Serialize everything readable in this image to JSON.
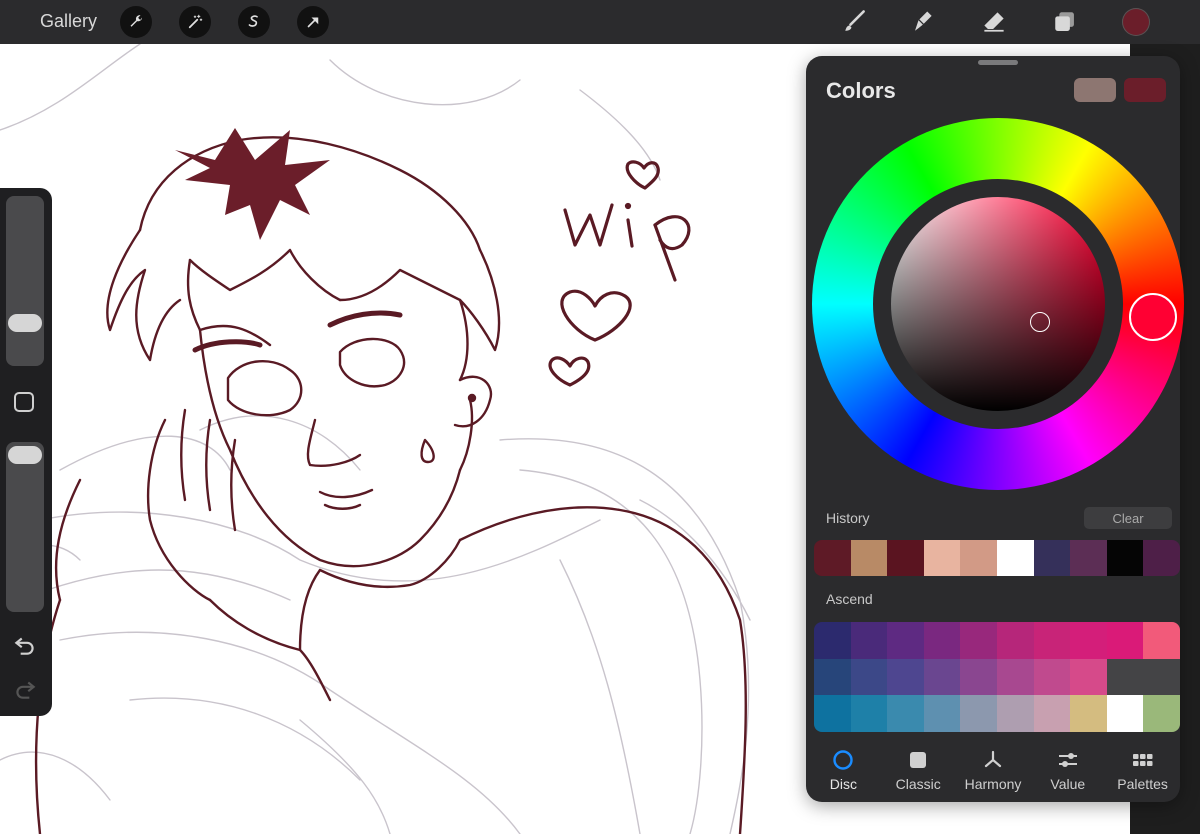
{
  "topbar": {
    "gallery_label": "Gallery",
    "left_tools": [
      "wrench-icon",
      "magic-wand-icon",
      "selection-icon",
      "transform-arrow-icon"
    ],
    "right_tools": [
      "brush-icon",
      "smudge-icon",
      "eraser-icon",
      "layers-icon"
    ],
    "current_color": "#6b1e2a"
  },
  "canvas": {
    "doodle_text": "wip"
  },
  "colors_panel": {
    "title": "Colors",
    "primary_swatch": "#8d7671",
    "secondary_swatch": "#6b1e2a",
    "history_label": "History",
    "clear_label": "Clear",
    "history": [
      "#5e1a26",
      "#b88a66",
      "#5a1420",
      "#e8b4a0",
      "#d29a86",
      "#ffffff",
      "#35305a",
      "#5c2e55",
      "#050505",
      "#4e1f48"
    ],
    "palette_name": "Ascend",
    "palette": [
      [
        "#2c2a6e",
        "#4a2a7a",
        "#5e2a82",
        "#7a2880",
        "#98287c",
        "#b6267a",
        "#c82478",
        "#d41e7a",
        "#da1a78",
        "#f25a7a"
      ],
      [
        "#27457a",
        "#3c4888",
        "#4e4690",
        "#6a4690",
        "#8a4690",
        "#a84890",
        "#c04a8e",
        "#d64a8a",
        "#444446",
        "#444446"
      ],
      [
        "#0e72a0",
        "#1e80a8",
        "#3a8aae",
        "#5e90b0",
        "#8c98ae",
        "#ae9eb0",
        "#c8a0b0",
        "#d4bc80",
        "#ffffff",
        "#9ab87a"
      ]
    ],
    "tabs": [
      {
        "label": "Disc",
        "icon": "disc-icon"
      },
      {
        "label": "Classic",
        "icon": "classic-square-icon"
      },
      {
        "label": "Harmony",
        "icon": "harmony-icon"
      },
      {
        "label": "Value",
        "icon": "value-sliders-icon"
      },
      {
        "label": "Palettes",
        "icon": "palettes-grid-icon"
      }
    ],
    "active_tab": "Disc",
    "accent": "#1a8cff"
  }
}
